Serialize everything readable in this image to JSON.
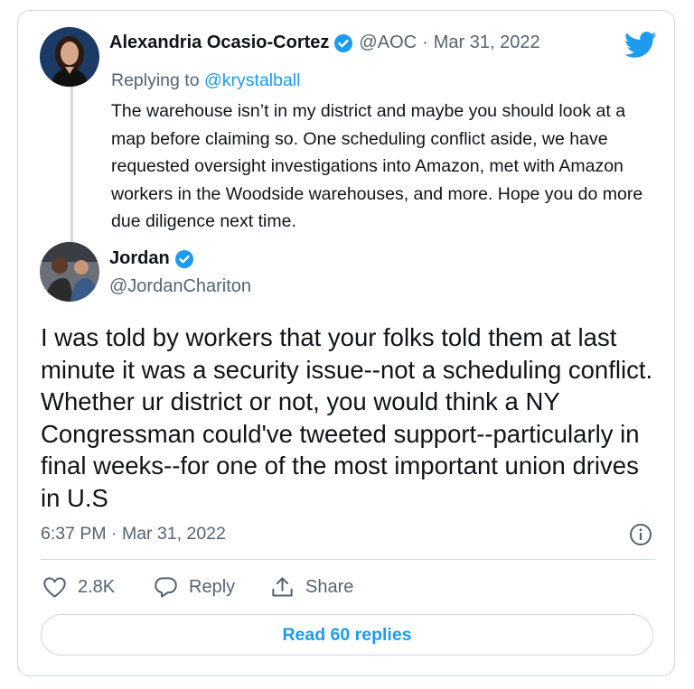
{
  "quoted": {
    "author_name": "Alexandria Ocasio-Cortez",
    "handle": "@AOC",
    "separator": "·",
    "date": "Mar 31, 2022",
    "replying_prefix": "Replying to",
    "replying_to": "@krystalball",
    "text": "The warehouse isn’t in my district and maybe you should look at a map before claiming so. One scheduling conflict aside, we have requested oversight investigations into Amazon, met with Amazon workers in the Woodside warehouses, and more. Hope you do more due diligence next time."
  },
  "tweet": {
    "author_name": "Jordan",
    "handle": "@JordanChariton",
    "text": "I was told by workers that your folks told them at last minute it was a security issue--not a scheduling conflict. Whether ur district or not, you would think a NY Congressman could've tweeted support--particularly in final weeks--for one of the most important union drives in U.S",
    "timestamp": "6:37 PM · Mar 31, 2022"
  },
  "actions": {
    "like_count": "2.8K",
    "reply_label": "Reply",
    "share_label": "Share"
  },
  "read_replies_label": "Read 60 replies",
  "colors": {
    "accent": "#1d9bf0",
    "muted_text": "#536471",
    "border": "#cfd9de"
  },
  "icons": [
    "twitter-logo-icon",
    "verified-badge-icon",
    "heart-icon",
    "reply-bubble-icon",
    "share-icon",
    "info-icon"
  ]
}
